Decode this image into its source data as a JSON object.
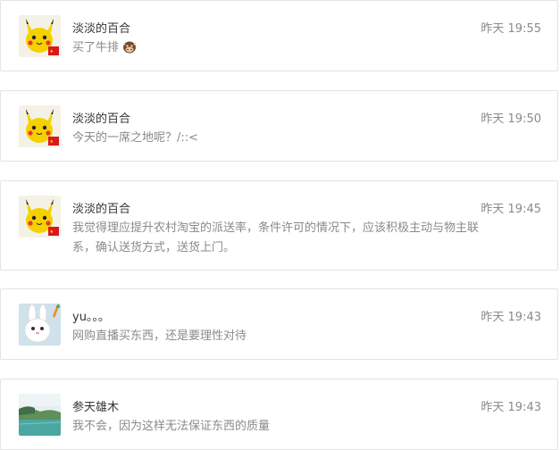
{
  "comments": [
    {
      "user": "淡淡的百合",
      "time": "昨天 19:55",
      "text": "买了牛排",
      "avatar": "pikachu-avatar",
      "emoji": "cow-icon"
    },
    {
      "user": "淡淡的百合",
      "time": "昨天 19:50",
      "text": "今天的一席之地呢？/::<",
      "avatar": "pikachu-avatar"
    },
    {
      "user": "淡淡的百合",
      "time": "昨天 19:45",
      "text": "我觉得理应提升农村淘宝的派送率，条件许可的情况下，应该积极主动与物主联系，确认送货方式，送货上门。",
      "avatar": "pikachu-avatar"
    },
    {
      "user": "yu。。。",
      "time": "昨天 19:43",
      "text": "网购直播买东西，还是要理性对待",
      "avatar": "rabbit-avatar"
    },
    {
      "user": "参天雄木",
      "time": "昨天 19:43",
      "text": "我不会，因为这样无法保证东西的质量",
      "avatar": "lake-landscape-avatar"
    }
  ]
}
